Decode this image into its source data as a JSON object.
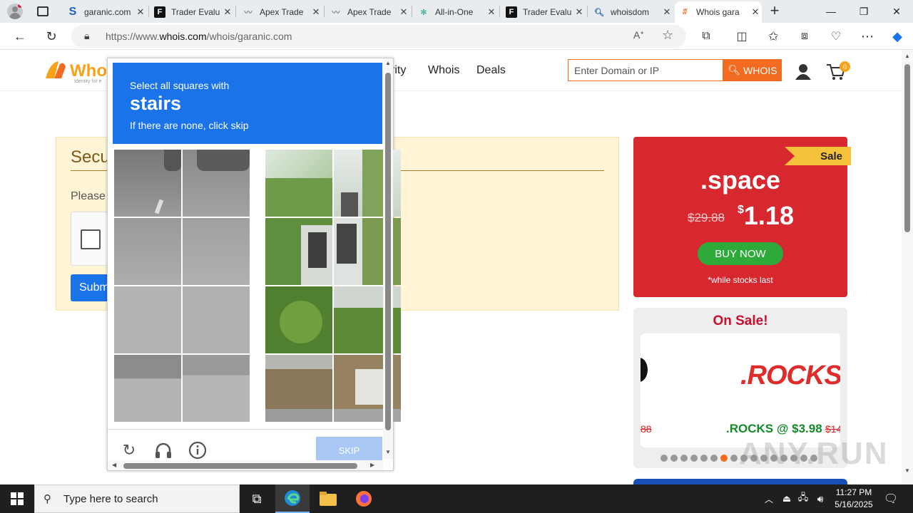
{
  "browser": {
    "tabs": [
      {
        "label": "garanic.com",
        "icon": "s-icon"
      },
      {
        "label": "Trader Evalu",
        "icon": "f-icon"
      },
      {
        "label": "Apex Trade",
        "icon": "apex-icon"
      },
      {
        "label": "Apex Trade",
        "icon": "apex-icon"
      },
      {
        "label": "All-in-One",
        "icon": "allinone-icon"
      },
      {
        "label": "Trader Evalu",
        "icon": "f-icon"
      },
      {
        "label": "whoisdom",
        "icon": "search-icon"
      },
      {
        "label": "Whois gara",
        "icon": "whois-icon"
      }
    ],
    "url_prefix": "https://www.",
    "url_domain": "whois.com",
    "url_path": "/whois/garanic.com"
  },
  "site": {
    "nav": [
      "rity",
      "Whois",
      "Deals"
    ],
    "search_placeholder": "Enter Domain or IP",
    "search_button": "WHOIS",
    "cart_count": "0",
    "security_title": "Secu",
    "security_text": "Please",
    "submit_label": "Subm"
  },
  "captcha": {
    "instruction": "Select all squares with",
    "object": "stairs",
    "hint": "If there are none, click skip",
    "skip_label": "SKIP"
  },
  "promo": {
    "tag": "Sale",
    "tld": ".space",
    "old_price": "$29.88",
    "currency": "$",
    "new_price": "1.18",
    "buy_label": "BUY NOW",
    "disclaimer": "*while stocks last",
    "onsale_title": "On Sale!",
    "rocks_logo": ".ROCKS",
    "rocks_offer": ".ROCKS @ $3.98",
    "rocks_old": "$14",
    "prev_old": "88",
    "dot_count": 16,
    "active_dot": 6
  },
  "taskbar": {
    "search_placeholder": "Type here to search",
    "time": "11:27 PM",
    "date": "5/16/2025"
  },
  "watermark": "ANY.RUN",
  "colors": {
    "accent": "#f26b21",
    "captcha_blue": "#1a73e8",
    "sale_red": "#d7282f",
    "buy_green": "#2eaa3b"
  }
}
